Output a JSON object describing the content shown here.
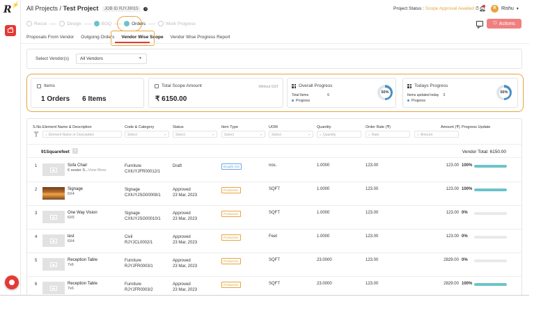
{
  "brand": {
    "logo_text": "R",
    "accent": "#e53935"
  },
  "header": {
    "breadcrumb_root": "All Projects",
    "separator": "/",
    "project_name": "Test Project",
    "job_id_label": "JOB ID",
    "job_id": "RJYJ9015",
    "project_status_label": "Project Status :",
    "project_status": "Scope Approval Awaited",
    "user_initial": "R",
    "user_name": "Rishu"
  },
  "stepper": [
    {
      "label": "Recce",
      "state": "pending"
    },
    {
      "label": "Design",
      "state": "pending"
    },
    {
      "label": "BOQ",
      "state": "done"
    },
    {
      "label": "Orders",
      "state": "current"
    },
    {
      "label": "Work Progress",
      "state": "pending"
    }
  ],
  "actions_label": "Actions",
  "tabs": [
    {
      "label": "Proposals From Vendor",
      "active": false
    },
    {
      "label": "Outgoing Orders",
      "active": false
    },
    {
      "label": "Vendor Wise Scope",
      "active": true
    },
    {
      "label": "Vendor Wise Progress Report",
      "active": false
    }
  ],
  "vendor_filter": {
    "label": "Select Vendor(s)",
    "value": "All Vendors"
  },
  "summary": {
    "items_title": "Items",
    "orders_count": "1 Orders",
    "items_count": "6 Items",
    "scope_title": "Total Scope Amount",
    "scope_note": "Without GST",
    "scope_amount": "₹ 6150.00",
    "overall_title": "Overall Progress",
    "overall_items_label": "Total Items",
    "overall_items_value": "6",
    "overall_legend": "Progress",
    "overall_pct_label": "50%",
    "overall_pct": 50,
    "today_title": "Todays Progress",
    "today_items_label": "Items updated today",
    "today_items_value": "3",
    "today_legend": "Progress",
    "today_pct_label": "50%",
    "today_pct": 50
  },
  "table": {
    "headers": {
      "sno": "S.No.",
      "element": "Element Name & Description",
      "code": "Code & Category",
      "status": "Status",
      "item_type": "Item Type",
      "uom": "UOM",
      "quantity": "Quantity",
      "order_rate": "Order Rate (₹)",
      "amount": "Amount (₹)",
      "progress": "Progress Update"
    },
    "filters": {
      "element_placeholder": "Element Name or Description",
      "select": "Select",
      "quantity": "Quantity",
      "rate": "Rate",
      "amount": "Amount"
    },
    "group": {
      "name": "91Squarefeet",
      "badge": "4",
      "total": "Vendor Total: 6150.00"
    },
    "rows": [
      {
        "sno": "1",
        "name": "Sofa Chair",
        "desc": "6 seater S...",
        "more": "View More",
        "category": "Furniture",
        "code": "CXIUYJFR00012/1",
        "status": "Draft",
        "date": "",
        "type": "Bought Out",
        "uom": "nos.",
        "qty": "1.0000",
        "rate": "123.00",
        "amount": "123.00",
        "pct_label": "100%",
        "pct": 100,
        "photo": false
      },
      {
        "sno": "2",
        "name": "Signage",
        "desc": "6X4",
        "more": "",
        "category": "Signage",
        "code": "CXIUYJSG00008/1",
        "status": "Approved",
        "date": "23 Mar, 2023",
        "type": "Production",
        "uom": "SQFT",
        "qty": "1.0000",
        "rate": "123.00",
        "amount": "123.00",
        "pct_label": "100%",
        "pct": 100,
        "photo": true
      },
      {
        "sno": "3",
        "name": "One Way Vision",
        "desc": "6X5",
        "more": "",
        "category": "Signage",
        "code": "CXIUYJSG00010/1",
        "status": "Approved",
        "date": "23 Mar, 2023",
        "type": "Production",
        "uom": "SQFT",
        "qty": "1.0000",
        "rate": "123.00",
        "amount": "123.00",
        "pct_label": "0%",
        "pct": 0,
        "photo": false
      },
      {
        "sno": "4",
        "name": "test",
        "desc": "6X4",
        "more": "",
        "category": "Civil",
        "code": "RJYJCL0002/1",
        "status": "Approved",
        "date": "23 Mar, 2023",
        "type": "Production",
        "uom": "Feet",
        "qty": "1.0000",
        "rate": "123.00",
        "amount": "123.00",
        "pct_label": "0%",
        "pct": 0,
        "photo": false
      },
      {
        "sno": "5",
        "name": "Reception Table",
        "desc": "7x6",
        "more": "",
        "category": "Furniture",
        "code": "RJYJFR0003/1",
        "status": "Approved",
        "date": "23 Mar, 2023",
        "type": "Production",
        "uom": "SQFT",
        "qty": "23.0000",
        "rate": "123.00",
        "amount": "2829.00",
        "pct_label": "0%",
        "pct": 0,
        "photo": false
      },
      {
        "sno": "6",
        "name": "Reception Table",
        "desc": "7x6",
        "more": "",
        "category": "Furniture",
        "code": "RJYJFR0003/2",
        "status": "Approved",
        "date": "23 Mar, 2023",
        "type": "Production",
        "uom": "SQFT",
        "qty": "23.0000",
        "rate": "123.00",
        "amount": "2829.00",
        "pct_label": "100%",
        "pct": 100,
        "photo": false
      }
    ]
  },
  "colors": {
    "teal": "#6cc3c9",
    "orange_highlight": "#e8a33d",
    "bought_out": "#6aa7e0",
    "production": "#e8a33d",
    "donut_track": "#dfe6ec",
    "donut_fill": "#4a90c2"
  },
  "icons": [
    "bolt-logo-icon",
    "briefcase-icon",
    "info-icon",
    "clock-icon",
    "bell-icon",
    "chat-icon",
    "filter-icon",
    "image-icon",
    "chat-fab-icon"
  ]
}
